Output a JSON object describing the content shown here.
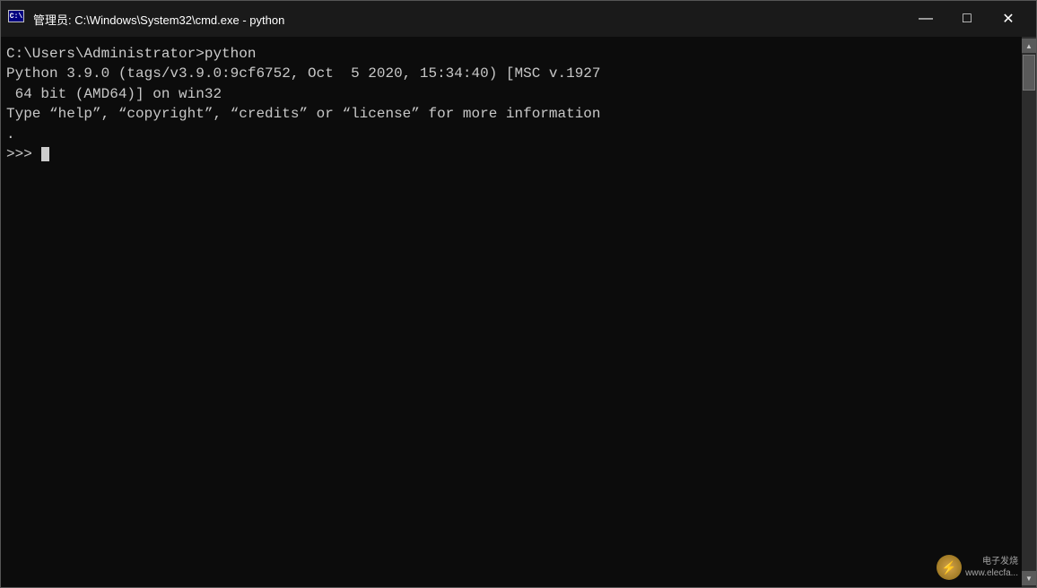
{
  "titleBar": {
    "icon": "cmd",
    "title": "管理员: C:\\Windows\\System32\\cmd.exe - python",
    "minimizeLabel": "minimize",
    "restoreLabel": "restore",
    "closeLabel": "close"
  },
  "terminal": {
    "lines": [
      {
        "id": "line1",
        "text": "C:\\Users\\Administrator>python",
        "type": "cmd-line"
      },
      {
        "id": "line2",
        "text": "Python 3.9.0 (tags/v3.9.0:9cf6752, Oct  5 2020, 15:34:40) [MSC v.1927",
        "type": "python-version"
      },
      {
        "id": "line3",
        "text": " 64 bit (AMD64)] on win32",
        "type": "python-version"
      },
      {
        "id": "line4",
        "text": "Type “help”, “copyright”, “credits” or “license” for more information",
        "type": "type-hint"
      },
      {
        "id": "line5",
        "text": ".",
        "type": "type-hint"
      },
      {
        "id": "line6",
        "text": ">>> ",
        "type": "prompt-line"
      }
    ]
  },
  "watermark": {
    "line1": "电子发烧",
    "line2": "www.elecfa..."
  }
}
